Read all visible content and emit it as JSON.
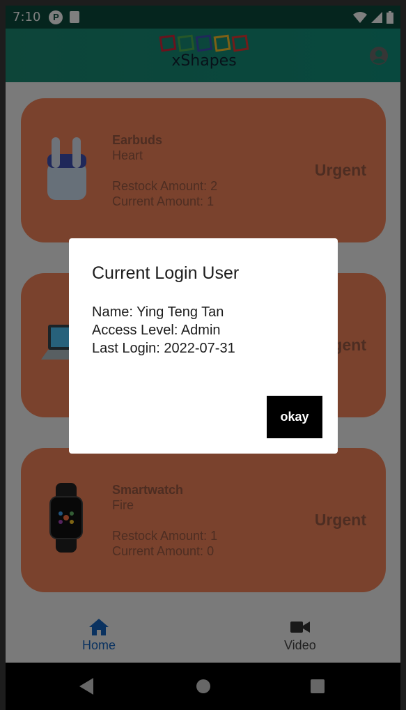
{
  "status_bar": {
    "time": "7:10"
  },
  "app_bar": {
    "logo_text": "xShapes"
  },
  "cards": [
    {
      "name": "Earbuds",
      "category": "Heart",
      "restock": "Restock Amount: 2",
      "current": "Current Amount: 1",
      "urgency": "Urgent"
    },
    {
      "name": "",
      "category": "",
      "restock": "",
      "current": "",
      "urgency": "Urgent"
    },
    {
      "name": "Smartwatch",
      "category": "Fire",
      "restock": "Restock Amount: 1",
      "current": "Current Amount: 0",
      "urgency": "Urgent"
    }
  ],
  "bottom_nav": {
    "home": "Home",
    "video": "Video"
  },
  "dialog": {
    "title": "Current Login User",
    "name_line": "Name: Ying Teng Tan",
    "access_line": "Access Level: Admin",
    "login_line": "Last Login: 2022-07-31",
    "okay": "okay"
  },
  "colors": {
    "card": "#f4845a",
    "appbar": "#1b8a73",
    "home_active": "#1565c0"
  },
  "icons": [
    "earbuds-icon",
    "laptop-icon",
    "smartwatch-icon",
    "home-icon",
    "video-icon",
    "account-icon"
  ]
}
